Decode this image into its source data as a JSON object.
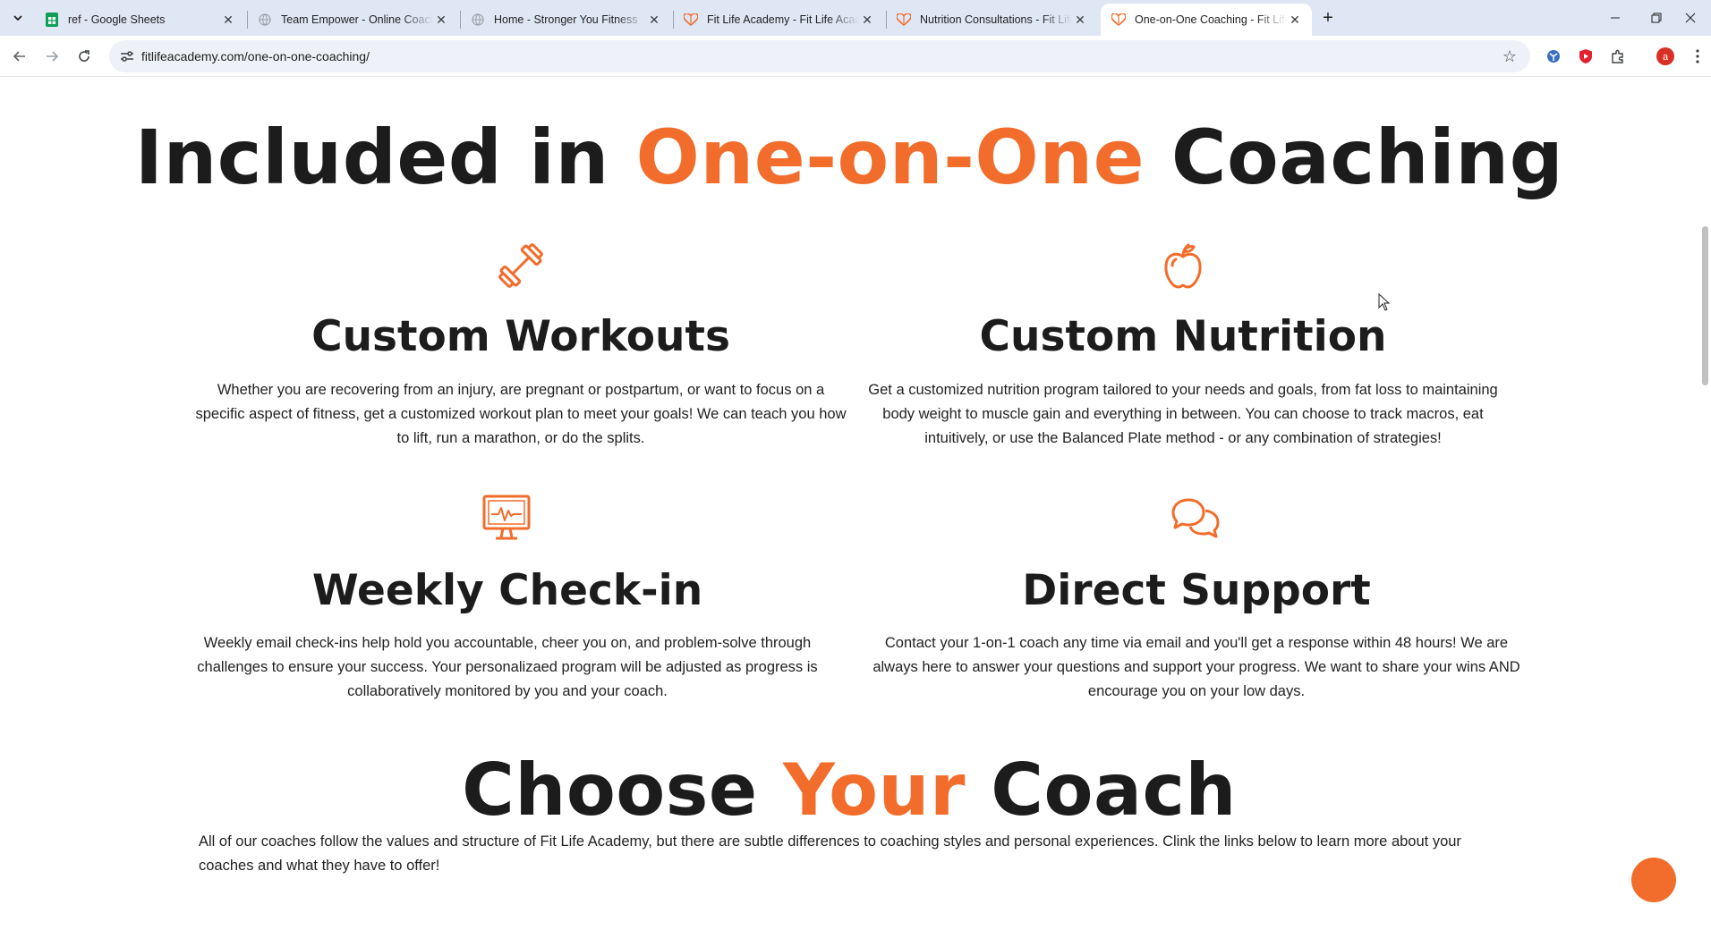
{
  "browser": {
    "tabs": [
      {
        "title": "ref - Google Sheets",
        "icon": "sheets-icon",
        "active": false
      },
      {
        "title": "Team Empower - Online Coaching",
        "icon": "globe-icon",
        "active": false
      },
      {
        "title": "Home - Stronger You Fitness",
        "icon": "globe-icon",
        "active": false
      },
      {
        "title": "Fit Life Academy - Fit Life Academy",
        "icon": "fitlife-heart-icon",
        "active": false
      },
      {
        "title": "Nutrition Consultations - Fit Life Academy",
        "icon": "fitlife-heart-icon",
        "active": false
      },
      {
        "title": "One-on-One Coaching - Fit Life Academy",
        "icon": "fitlife-heart-icon",
        "active": true
      }
    ],
    "new_tab_label": "+",
    "url": "fitlifeacademy.com/one-on-one-coaching/",
    "profile_initial": "a",
    "accent": "#f26d2b"
  },
  "page": {
    "included_heading": {
      "before": "Included in ",
      "highlight": "One-on-One",
      "after": " Coaching"
    },
    "features": [
      {
        "icon": "dumbbell-icon",
        "title": "Custom Workouts",
        "text": "Whether you are recovering from an injury, are pregnant or postpartum, or want to focus on a specific aspect of fitness, get a customized workout plan to meet your goals! We can teach you how to lift, run a marathon, or do the splits."
      },
      {
        "icon": "apple-icon",
        "title": "Custom Nutrition",
        "text": "Get a customized nutrition program tailored to your needs and goals, from fat loss to maintaining body weight to muscle gain and everything in between. You can choose to track macros, eat intuitively, or use the Balanced Plate method - or any combination of strategies!"
      },
      {
        "icon": "monitor-heartbeat-icon",
        "title": "Weekly Check-in",
        "text": "Weekly email check-ins help hold you accountable, cheer you on, and problem-solve through challenges to ensure your success. Your personalizaed program will be adjusted as progress is collaboratively monitored by you and your coach."
      },
      {
        "icon": "chat-bubbles-icon",
        "title": "Direct Support",
        "text": "Contact your 1-on-1 coach any time via email and you'll get a response within 48 hours! We are always here to answer your questions and support your progress. We want to share your wins AND encourage you on your low days."
      }
    ],
    "coach_heading": {
      "before": "Choose ",
      "highlight": "Your",
      "after": " Coach"
    },
    "coach_intro": "All of our coaches follow the values and structure of Fit Life Academy, but there are subtle differences to coaching styles and personal experiences. Clink the links below to learn more about your coaches and what they have to offer!"
  }
}
